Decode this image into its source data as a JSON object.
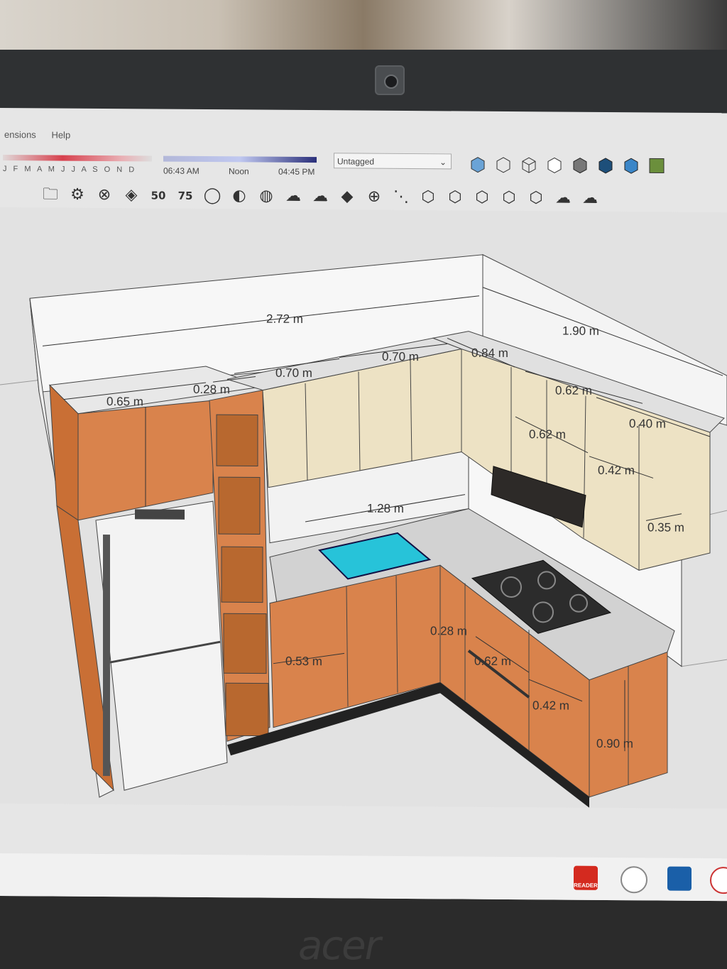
{
  "menu": {
    "items": [
      "ensions",
      "Help"
    ]
  },
  "shadow_settings": {
    "months": "J F M A M J J A S O N D",
    "time_start": "06:43 AM",
    "time_mid": "Noon",
    "time_end": "04:45 PM"
  },
  "tag_select": {
    "value": "Untagged"
  },
  "toolbar2": {
    "num_50": "50",
    "num_75": "75"
  },
  "dimensions": {
    "total_width": "2.72 m",
    "right_wall": "1.90 m",
    "tall_unit_depth": "0.65 m",
    "shelf_width": "0.28 m",
    "upper_1": "0.70 m",
    "upper_2": "0.70 m",
    "corner_upper": "0.84 m",
    "upper_right_1": "0.62 m",
    "upper_right_2": "0.40 m",
    "upper_depth_1": "0.62 m",
    "upper_depth_2": "0.42 m",
    "upper_height": "0.35 m",
    "sink_run": "1.28 m",
    "base_left": "0.53 m",
    "base_corner": "0.28 m",
    "base_right_1": "0.62 m",
    "base_right_2": "0.42 m",
    "base_height": "0.90 m"
  },
  "colors": {
    "wood": "#d9834c",
    "upper_cabinet": "#ede2c4",
    "countertop": "#d2d2d2",
    "sink": "#27c3d9",
    "wall": "#f7f7f7"
  },
  "taskbar": {
    "reader_label": "READER"
  },
  "bezel_logo": "acer"
}
